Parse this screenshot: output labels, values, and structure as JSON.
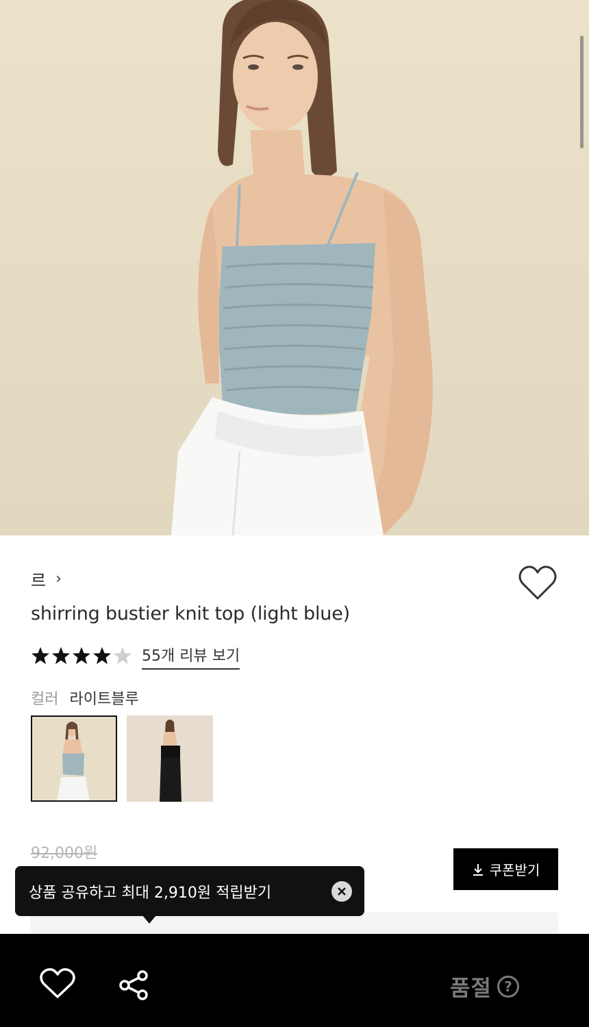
{
  "product": {
    "brand_label": "르",
    "title": "shirring bustier knit top (light blue)",
    "rating": 4.5,
    "review_link": "55개 리뷰 보기",
    "color_label": "컬러",
    "color_value": "라이트블루",
    "thumbnails": [
      {
        "color": "light-blue",
        "selected": true
      },
      {
        "color": "black",
        "selected": false
      }
    ],
    "original_price": "92,000원"
  },
  "coupon": {
    "label": "쿠폰받기",
    "icon": "download-icon"
  },
  "tooltip": {
    "text": "상품 공유하고 최대 2,910원 적립받기",
    "icon": "close-icon"
  },
  "bottom_bar": {
    "status": "품절",
    "help": "?",
    "icons": [
      "heart-icon",
      "share-icon"
    ]
  },
  "colors": {
    "accent": "#000000",
    "muted": "#9a9a9a",
    "strike_price": "#b5b5b5",
    "soldout": "#7a7a7a",
    "product_blue": "#9fb6bd"
  }
}
